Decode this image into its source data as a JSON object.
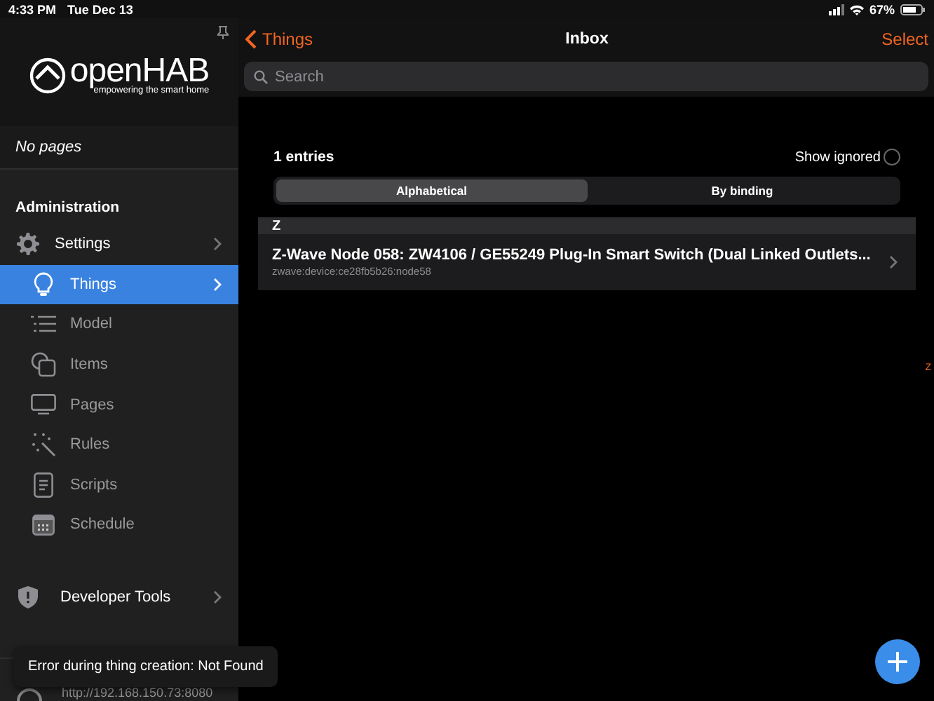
{
  "status_bar": {
    "time": "4:33 PM",
    "date": "Tue Dec 13",
    "battery": "67%"
  },
  "sidebar": {
    "logo": "openHAB",
    "tagline": "empowering the smart home",
    "no_pages": "No pages",
    "section_title": "Administration",
    "items": [
      {
        "label": "Settings",
        "kind": "top",
        "selected": false
      },
      {
        "label": "Things",
        "kind": "sub",
        "selected": true
      },
      {
        "label": "Model",
        "kind": "sub",
        "selected": false
      },
      {
        "label": "Items",
        "kind": "sub",
        "selected": false
      },
      {
        "label": "Pages",
        "kind": "sub",
        "selected": false
      },
      {
        "label": "Rules",
        "kind": "sub",
        "selected": false
      },
      {
        "label": "Scripts",
        "kind": "sub",
        "selected": false
      },
      {
        "label": "Schedule",
        "kind": "sub",
        "selected": false
      }
    ],
    "developer_tools": "Developer Tools",
    "server_url": "http://192.168.150.73:8080"
  },
  "navbar": {
    "back": "Things",
    "title": "Inbox",
    "action": "Select"
  },
  "search": {
    "placeholder": "Search"
  },
  "inbox": {
    "count": "1 entries",
    "show_ignored": {
      "label": "Show ignored",
      "checked": false
    },
    "segments": [
      {
        "label": "Alphabetical",
        "selected": true
      },
      {
        "label": "By binding",
        "selected": false
      }
    ],
    "groups": [
      {
        "letter": "Z",
        "items": [
          {
            "title": "Z-Wave Node 058: ZW4106 / GE55249 Plug-In Smart Switch (Dual Linked Outlets...",
            "subtitle": "zwave:device:ce28fb5b26:node58"
          }
        ]
      }
    ],
    "index_letters": [
      "Z"
    ]
  },
  "toast": {
    "message": "Error during thing creation: Not Found"
  }
}
